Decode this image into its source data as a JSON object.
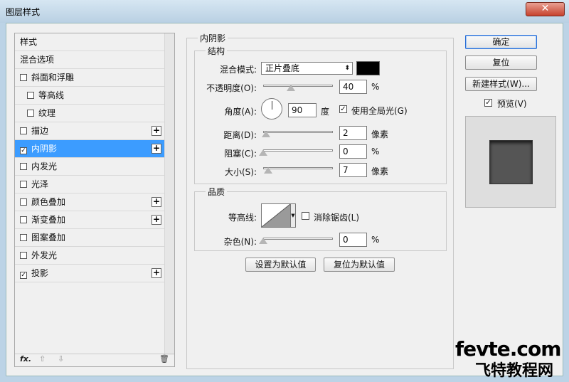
{
  "window": {
    "title": "图层样式",
    "close_label": "✕"
  },
  "left": {
    "items": [
      {
        "label": "样式",
        "checkbox": false,
        "checked": false,
        "plus": false,
        "sub": false,
        "selected": false
      },
      {
        "label": "混合选项",
        "checkbox": false,
        "checked": false,
        "plus": false,
        "sub": false,
        "selected": false
      },
      {
        "label": "斜面和浮雕",
        "checkbox": true,
        "checked": false,
        "plus": false,
        "sub": false,
        "selected": false
      },
      {
        "label": "等高线",
        "checkbox": true,
        "checked": false,
        "plus": false,
        "sub": true,
        "selected": false
      },
      {
        "label": "纹理",
        "checkbox": true,
        "checked": false,
        "plus": false,
        "sub": true,
        "selected": false
      },
      {
        "label": "描边",
        "checkbox": true,
        "checked": false,
        "plus": true,
        "sub": false,
        "selected": false
      },
      {
        "label": "内阴影",
        "checkbox": true,
        "checked": true,
        "plus": true,
        "sub": false,
        "selected": true
      },
      {
        "label": "内发光",
        "checkbox": true,
        "checked": false,
        "plus": false,
        "sub": false,
        "selected": false
      },
      {
        "label": "光泽",
        "checkbox": true,
        "checked": false,
        "plus": false,
        "sub": false,
        "selected": false
      },
      {
        "label": "颜色叠加",
        "checkbox": true,
        "checked": false,
        "plus": true,
        "sub": false,
        "selected": false
      },
      {
        "label": "渐变叠加",
        "checkbox": true,
        "checked": false,
        "plus": true,
        "sub": false,
        "selected": false
      },
      {
        "label": "图案叠加",
        "checkbox": true,
        "checked": false,
        "plus": false,
        "sub": false,
        "selected": false
      },
      {
        "label": "外发光",
        "checkbox": true,
        "checked": false,
        "plus": false,
        "sub": false,
        "selected": false
      },
      {
        "label": "投影",
        "checkbox": true,
        "checked": true,
        "plus": true,
        "sub": false,
        "selected": false
      }
    ],
    "footer": {
      "fx": "fx.",
      "up": "⇧",
      "down": "⇩",
      "trash": "🗑"
    }
  },
  "inner_shadow": {
    "title": "内阴影",
    "structure": {
      "title": "结构",
      "blend_mode_label": "混合模式:",
      "blend_mode_value": "正片叠底",
      "color": "#000000",
      "opacity_label": "不透明度(O):",
      "opacity_value": "40",
      "opacity_fraction": 0.4,
      "opacity_unit": "%",
      "angle_label": "角度(A):",
      "angle_value": "90",
      "angle_unit": "度",
      "global_light_label": "使用全局光(G)",
      "global_light_checked": true,
      "distance_label": "距离(D):",
      "distance_value": "2",
      "distance_unit": "像素",
      "choke_label": "阻塞(C):",
      "choke_value": "0",
      "choke_unit": "%",
      "size_label": "大小(S):",
      "size_value": "7",
      "size_unit": "像素"
    },
    "quality": {
      "title": "品质",
      "contour_label": "等高线:",
      "antialias_label": "消除锯齿(L)",
      "antialias_checked": false,
      "noise_label": "杂色(N):",
      "noise_value": "0",
      "noise_unit": "%"
    },
    "make_default_label": "设置为默认值",
    "reset_default_label": "复位为默认值"
  },
  "right": {
    "ok_label": "确定",
    "reset_label": "复位",
    "new_style_label": "新建样式(W)...",
    "preview_label": "预览(V)",
    "preview_checked": true
  },
  "watermark": {
    "line1": "fevte.com",
    "line2": "飞特教程网"
  }
}
